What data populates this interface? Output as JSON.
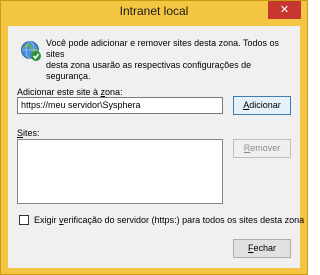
{
  "window": {
    "title": "Intranet local",
    "close_glyph": "✕"
  },
  "intro": {
    "icon": "globe-check-icon",
    "text": "Você pode adicionar e remover sites desta zona. Todos os sites\ndesta zona usarão as respectivas configurações de segurança."
  },
  "add_site": {
    "label_prefix": "Adicionar este site à ",
    "label_mnemonic": "z",
    "label_suffix": "ona:",
    "value": "https://meu servidor\\Sysphera",
    "button_mnemonic": "A",
    "button_rest": "dicionar"
  },
  "sites": {
    "label_mnemonic": "S",
    "label_rest": "ites:",
    "items": [],
    "remove_mnemonic": "R",
    "remove_rest": "emover"
  },
  "verify": {
    "checked": false,
    "label_prefix": "Exigir ",
    "label_mnemonic": "v",
    "label_suffix": "erificação do servidor (https:) para todos os sites desta zona"
  },
  "footer": {
    "close_mnemonic": "F",
    "close_rest": "echar"
  },
  "colors": {
    "titlebar": "#f4c542",
    "close_button": "#c7372f",
    "client_bg": "#f0f0f0"
  }
}
